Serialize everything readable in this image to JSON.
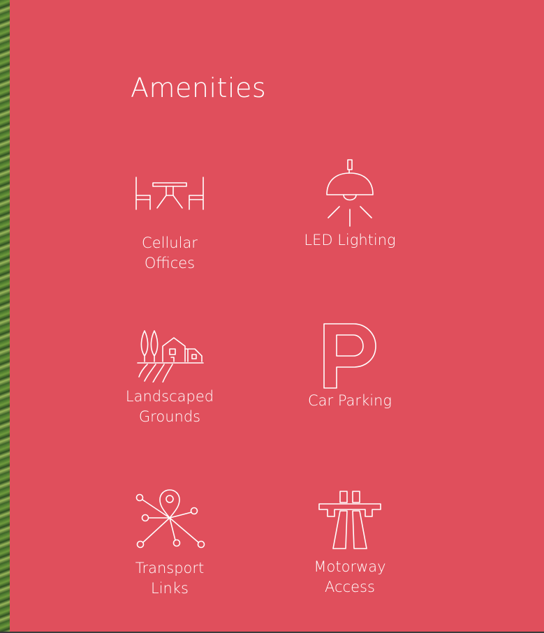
{
  "section": {
    "title": "Amenities"
  },
  "amenities": [
    {
      "label": "Cellular Offices",
      "icon": "office-desk-chairs-icon"
    },
    {
      "label": "LED Lighting",
      "icon": "pendant-lamp-icon"
    },
    {
      "label": "Landscaped Grounds",
      "icon": "landscape-house-icon"
    },
    {
      "label": "Car Parking",
      "icon": "parking-p-icon"
    },
    {
      "label": "Transport Links",
      "icon": "transport-network-pin-icon"
    },
    {
      "label": "Motorway Access",
      "icon": "motorway-bridge-icon"
    }
  ],
  "colors": {
    "panel_background": "#e04f5c",
    "text": "#ffffff",
    "foliage": "#6f9b3c"
  }
}
